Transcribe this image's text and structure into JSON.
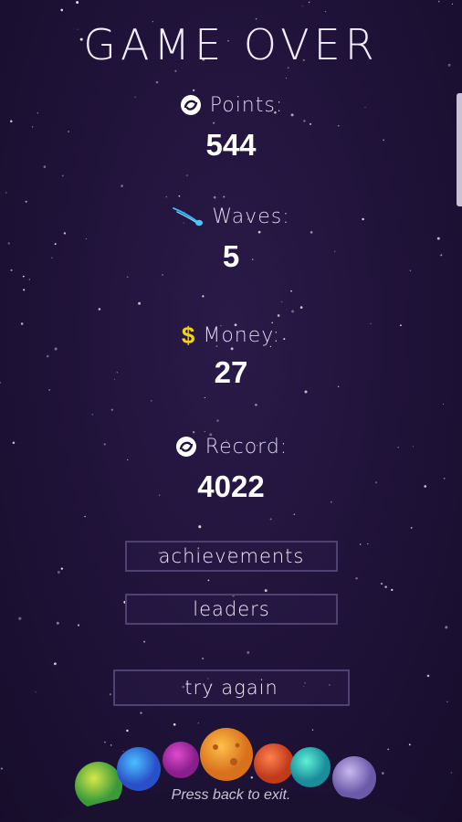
{
  "screen": {
    "title": "GAME OVER",
    "exit_hint": "Press back to exit."
  },
  "stats": {
    "points": {
      "label": "Points:",
      "value": "544",
      "icon": "swirl-icon"
    },
    "waves": {
      "label": "Waves:",
      "value": "5",
      "icon": "comet-icon"
    },
    "money": {
      "label": "Money:",
      "value": "27",
      "icon": "dollar-icon"
    },
    "record": {
      "label": "Record:",
      "value": "4022",
      "icon": "swirl-icon"
    }
  },
  "buttons": {
    "achievements": "achievements",
    "leaders": "leaders",
    "try_again": "try again"
  },
  "colors": {
    "background": "#1f1238",
    "money_icon": "#f2d21b",
    "comet_icon": "#38b8f0",
    "button_border": "#4f4270"
  }
}
